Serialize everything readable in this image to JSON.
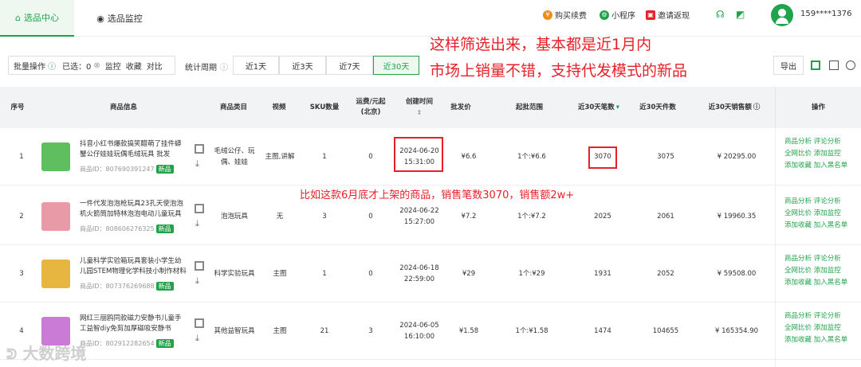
{
  "header": {
    "tabs": [
      {
        "label": "选品中心",
        "active": true,
        "icon": "home-icon"
      },
      {
        "label": "选品监控",
        "active": false,
        "icon": "monitor-icon"
      }
    ],
    "links": [
      "购买续费",
      "小程序",
      "邀请返现"
    ],
    "phone": "159****1376"
  },
  "toolbar": {
    "batch_label": "批量操作",
    "selected_label": "已选：0",
    "monitor_label": "监控",
    "favorite_label": "收藏",
    "compare_label": "对比",
    "period_label": "统计周期",
    "periods": [
      "近1天",
      "近3天",
      "近7天",
      "近30天"
    ],
    "active_period": "近30天",
    "export_label": "导出"
  },
  "annotations": {
    "top_line1": "这样筛选出来，基本都是近1月内",
    "top_line2": "市场上销量不错，支持代发模式的新品",
    "mid": "比如这款6月底才上架的商品，销售笔数3070，销售额2w+"
  },
  "table": {
    "headers": {
      "index": "序号",
      "product": "商品信息",
      "category": "商品类目",
      "video": "视频",
      "sku": "SKU数量",
      "shipping_line1": "运费/元起",
      "shipping_line2": "(北京)",
      "created": "创建时间",
      "price": "批发价",
      "range": "起批范围",
      "orders": "近30天笔数",
      "pieces": "近30天件数",
      "sales": "近30天销售额",
      "ops": "操作"
    },
    "id_prefix": "商品ID：",
    "new_tag": "新品",
    "op_links": [
      "商品分析",
      "评论分析",
      "全网比价",
      "添加监控",
      "添加收藏",
      "加入黑名单"
    ],
    "rows": [
      {
        "index": "1",
        "title": "抖音小红书爆款搞笑醋萌了挂件蟒蟹公仔娃娃玩偶毛绒玩具 批发",
        "pid": "807690391247",
        "category": "毛绒公仔、玩偶、娃娃",
        "video": "主图,讲解",
        "sku": "1",
        "shipping": "0",
        "created_date": "2024-06-20",
        "created_time": "15:31:00",
        "price": "¥6.6",
        "range": "1个:¥6.6",
        "orders": "3070",
        "pieces": "3075",
        "sales": "¥ 20295.00",
        "thumb": "#5fbf5f"
      },
      {
        "index": "2",
        "title": "一件代发泡泡枪玩具23孔天使泡泡机火箭筒加特林泡泡电动儿童玩具",
        "pid": "808606276325",
        "category": "泡泡玩具",
        "video": "无",
        "sku": "3",
        "shipping": "0",
        "created_date": "2024-06-22",
        "created_time": "15:27:00",
        "price": "¥7.2",
        "range": "1个:¥7.2",
        "orders": "2025",
        "pieces": "2061",
        "sales": "¥ 19960.35",
        "thumb": "#e89aa6"
      },
      {
        "index": "3",
        "title": "儿童科学实验箱玩具套装小学生幼儿园STEM物理化学科技小制作材料",
        "pid": "807376269688",
        "category": "科学实验玩具",
        "video": "主图",
        "sku": "1",
        "shipping": "0",
        "created_date": "2024-06-18",
        "created_time": "22:59:00",
        "price": "¥29",
        "range": "1个:¥29",
        "orders": "1931",
        "pieces": "2052",
        "sales": "¥ 59508.00",
        "thumb": "#e6b640"
      },
      {
        "index": "4",
        "title": "网红三丽鸥同款磁力安静书儿童手工益智diy免剪加厚磁吸安静书",
        "pid": "802912282654",
        "category": "其他益智玩具",
        "video": "主图",
        "sku": "21",
        "shipping": "3",
        "created_date": "2024-06-05",
        "created_time": "16:10:00",
        "price": "¥1.58",
        "range": "1个:¥1.58",
        "orders": "1474",
        "pieces": "104655",
        "sales": "¥ 165354.90",
        "thumb": "#c97bd6"
      }
    ]
  },
  "watermark": "大数跨境"
}
